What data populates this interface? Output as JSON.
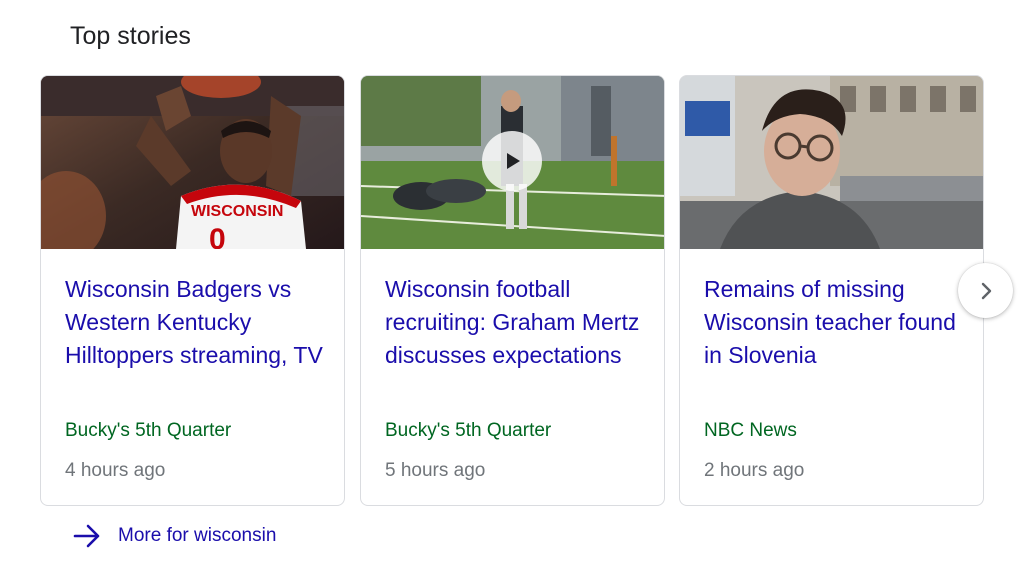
{
  "section": {
    "title": "Top stories"
  },
  "stories": [
    {
      "headline": "Wisconsin Badgers vs Western Kentucky Hilltoppers streaming, TV",
      "source": "Bucky's 5th Quarter",
      "time": "4 hours ago",
      "image_icon": "basketball-player-photo",
      "jersey_text": "WISCONSIN",
      "jersey_number": "0"
    },
    {
      "headline": "Wisconsin football recruiting: Graham Mertz discusses expectations",
      "source": "Bucky's 5th Quarter",
      "time": "5 hours ago",
      "image_icon": "football-practice-video",
      "has_video": true
    },
    {
      "headline": "Remains of missing Wisconsin teacher found in Slovenia",
      "source": "NBC News",
      "time": "2 hours ago",
      "image_icon": "person-portrait-photo"
    }
  ],
  "carousel": {
    "next_icon": "chevron-right-icon"
  },
  "more": {
    "label": "More for wisconsin",
    "icon": "arrow-right-icon"
  },
  "colors": {
    "headline": "#1a0dab",
    "source": "#006621",
    "time": "#70757a",
    "border": "#dadce0",
    "jersey_red": "#c5050c"
  }
}
